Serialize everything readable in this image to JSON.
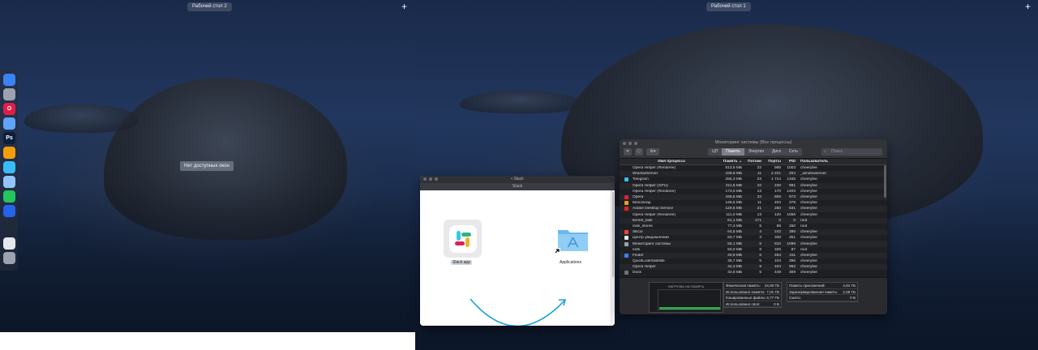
{
  "spaces": {
    "left_label": "Рабочий стол 2",
    "right_label": "Рабочий стол 1",
    "add_symbol": "+"
  },
  "toast": "Нет доступных окон",
  "dock": {
    "items": [
      {
        "name": "finder-icon",
        "color": "#3b82f6",
        "glyph": ""
      },
      {
        "name": "launchpad-icon",
        "color": "#9ca3af",
        "glyph": ""
      },
      {
        "name": "opera-icon",
        "color": "#e11d48",
        "glyph": "O"
      },
      {
        "name": "mail-icon",
        "color": "#60a5fa",
        "glyph": ""
      },
      {
        "name": "photoshop-icon",
        "color": "#0b1e3a",
        "glyph": "Ps"
      },
      {
        "name": "blender-icon",
        "color": "#f59e0b",
        "glyph": ""
      },
      {
        "name": "telegram-icon",
        "color": "#38bdf8",
        "glyph": ""
      },
      {
        "name": "preview-icon",
        "color": "#93c5fd",
        "glyph": ""
      },
      {
        "name": "spotify-icon",
        "color": "#22c55e",
        "glyph": ""
      },
      {
        "name": "vscode-icon",
        "color": "#2563eb",
        "glyph": ""
      },
      {
        "name": "activity-monitor-icon",
        "color": "#1f2937",
        "glyph": ""
      },
      {
        "name": "finder-doc-icon",
        "color": "#e5e7eb",
        "glyph": ""
      },
      {
        "name": "trash-icon",
        "color": "#9ca3af",
        "glyph": ""
      }
    ]
  },
  "dmg_window": {
    "title": "Slack",
    "tab": "Slack",
    "app_label": "Slack.app",
    "folder_label": "Applications"
  },
  "activity_monitor": {
    "title": "Мониторинг системы (Все процессы)",
    "tabs": [
      "ЦП",
      "Память",
      "Энергия",
      "Диск",
      "Сеть"
    ],
    "active_tab": "Память",
    "search_placeholder": "Поиск",
    "columns": {
      "name": "Имя процесса",
      "memory": "Память ⌄",
      "threads": "Потоки",
      "ports": "Порты",
      "pid": "PID",
      "user": "Пользователь"
    },
    "rows": [
      {
        "icon": "",
        "name": "Opera Helper (Renderer)",
        "memory": "613,6 МБ",
        "threads": "22",
        "ports": "985",
        "pid": "1003",
        "user": "cheerylee"
      },
      {
        "icon": "",
        "name": "WindowServer",
        "memory": "439,9 МБ",
        "threads": "11",
        "ports": "2 221",
        "pid": "204",
        "user": "_windowserver"
      },
      {
        "icon": "#38bdf8",
        "name": "Telegram",
        "memory": "256,3 МБ",
        "threads": "23",
        "ports": "1 714",
        "pid": "1345",
        "user": "cheerylee"
      },
      {
        "icon": "",
        "name": "Opera Helper (GPU)",
        "memory": "211,6 МБ",
        "threads": "10",
        "ports": "230",
        "pid": "991",
        "user": "cheerylee"
      },
      {
        "icon": "",
        "name": "Opera Helper (Renderer)",
        "memory": "173,0 МБ",
        "threads": "13",
        "ports": "170",
        "pid": "1403",
        "user": "cheerylee"
      },
      {
        "icon": "#e11d48",
        "name": "Opera",
        "memory": "166,5 МБ",
        "threads": "32",
        "ports": "806",
        "pid": "973",
        "user": "cheerylee"
      },
      {
        "icon": "#f59e0b",
        "name": "Monosnap",
        "memory": "148,5 МБ",
        "threads": "11",
        "ports": "403",
        "pid": "378",
        "user": "cheerylee"
      },
      {
        "icon": "#dc2626",
        "name": "Adobe Desktop Service",
        "memory": "120,5 МБ",
        "threads": "21",
        "ports": "250",
        "pid": "531",
        "user": "cheerylee"
      },
      {
        "icon": "",
        "name": "Opera Helper (Renderer)",
        "memory": "111,0 МБ",
        "threads": "13",
        "ports": "120",
        "pid": "1066",
        "user": "cheerylee"
      },
      {
        "icon": "",
        "name": "kernel_task",
        "memory": "81,1 МБ",
        "threads": "171",
        "ports": "0",
        "pid": "0",
        "user": "root"
      },
      {
        "icon": "",
        "name": "mds_stores",
        "memory": "77,3 МБ",
        "threads": "5",
        "ports": "88",
        "pid": "250",
        "user": "root"
      },
      {
        "icon": "#ef4444",
        "name": "Sllicio",
        "memory": "64,5 МБ",
        "threads": "4",
        "ports": "242",
        "pid": "395",
        "user": "cheerylee"
      },
      {
        "icon": "#e5e7eb",
        "name": "Центр уведомлений",
        "memory": "60,7 МБ",
        "threads": "3",
        "ports": "338",
        "pid": "351",
        "user": "cheerylee"
      },
      {
        "icon": "#9ca3af",
        "name": "Мониторинг системы",
        "memory": "55,1 МБ",
        "threads": "5",
        "ports": "810",
        "pid": "1099",
        "user": "cheerylee"
      },
      {
        "icon": "",
        "name": "mds",
        "memory": "50,0 МБ",
        "threads": "8",
        "ports": "325",
        "pid": "87",
        "user": "root"
      },
      {
        "icon": "#3b82f6",
        "name": "Finder",
        "memory": "40,9 МБ",
        "threads": "6",
        "ports": "484",
        "pid": "311",
        "user": "cheerylee"
      },
      {
        "icon": "",
        "name": "QuickLookSatellite",
        "memory": "36,7 МБ",
        "threads": "5",
        "ports": "103",
        "pid": "396",
        "user": "cheerylee"
      },
      {
        "icon": "",
        "name": "Opera Helper",
        "memory": "34,3 МБ",
        "threads": "9",
        "ports": "104",
        "pid": "992",
        "user": "cheerylee"
      },
      {
        "icon": "#6b7280",
        "name": "Dock",
        "memory": "32,5 МБ",
        "threads": "5",
        "ports": "449",
        "pid": "309",
        "user": "cheerylee"
      }
    ],
    "memory_pressure_title": "НАГРУЗКА НА ПАМЯТЬ",
    "stats_a": [
      {
        "label": "Физическая память:",
        "value": "24,00 ГБ"
      },
      {
        "label": "Использовано памяти:",
        "value": "7,01 ГБ"
      },
      {
        "label": "Кэшированные файлы:",
        "value": "4,77 ГБ"
      },
      {
        "label": "Использовано своп:",
        "value": "0 Б"
      }
    ],
    "stats_b": [
      {
        "label": "Память приложений:",
        "value": "4,94 ГБ"
      },
      {
        "label": "Зарезервированная память:",
        "value": "2,08 ГБ"
      },
      {
        "label": "Сжато:",
        "value": "0 Б"
      }
    ]
  }
}
